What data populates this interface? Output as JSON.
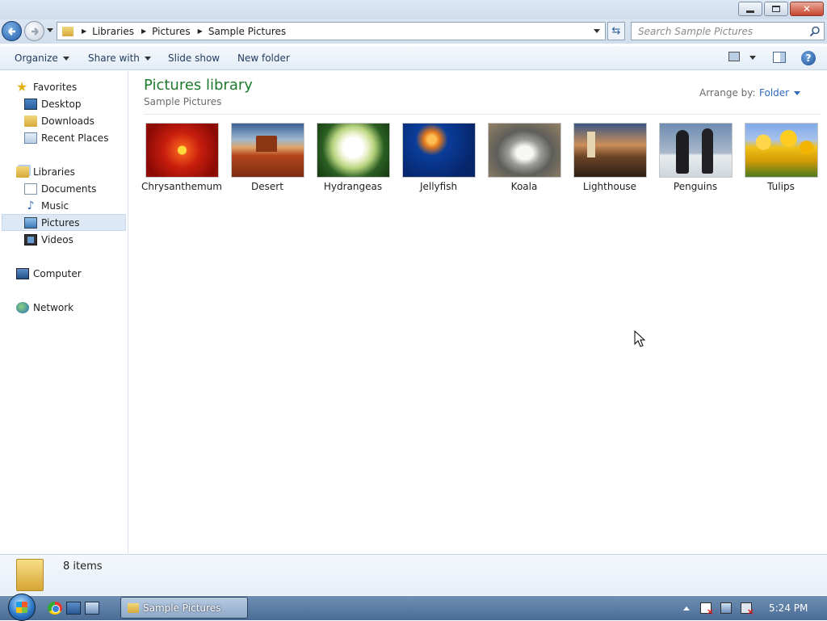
{
  "breadcrumb": [
    "Libraries",
    "Pictures",
    "Sample Pictures"
  ],
  "search": {
    "placeholder": "Search Sample Pictures"
  },
  "toolbar": {
    "organize": "Organize",
    "share_with": "Share with",
    "slide_show": "Slide show",
    "new_folder": "New folder",
    "help": "?"
  },
  "nav": {
    "favorites": "Favorites",
    "desktop": "Desktop",
    "downloads": "Downloads",
    "recent_places": "Recent Places",
    "libraries": "Libraries",
    "documents": "Documents",
    "music": "Music",
    "pictures": "Pictures",
    "videos": "Videos",
    "computer": "Computer",
    "network": "Network"
  },
  "library": {
    "title": "Pictures library",
    "subtitle": "Sample Pictures",
    "arrange_label": "Arrange by:",
    "arrange_value": "Folder"
  },
  "pictures": [
    {
      "name": "Chrysanthemum"
    },
    {
      "name": "Desert"
    },
    {
      "name": "Hydrangeas"
    },
    {
      "name": "Jellyfish"
    },
    {
      "name": "Koala"
    },
    {
      "name": "Lighthouse"
    },
    {
      "name": "Penguins"
    },
    {
      "name": "Tulips"
    }
  ],
  "details": {
    "item_count": "8 items"
  },
  "taskbar": {
    "window_button": "Sample Pictures",
    "clock": "5:24 PM"
  },
  "colors": {
    "library_title": "#1e7a2c",
    "link_blue": "#2e6bbd",
    "taskbar": "#4a6c96",
    "close_button": "#c7452e"
  }
}
